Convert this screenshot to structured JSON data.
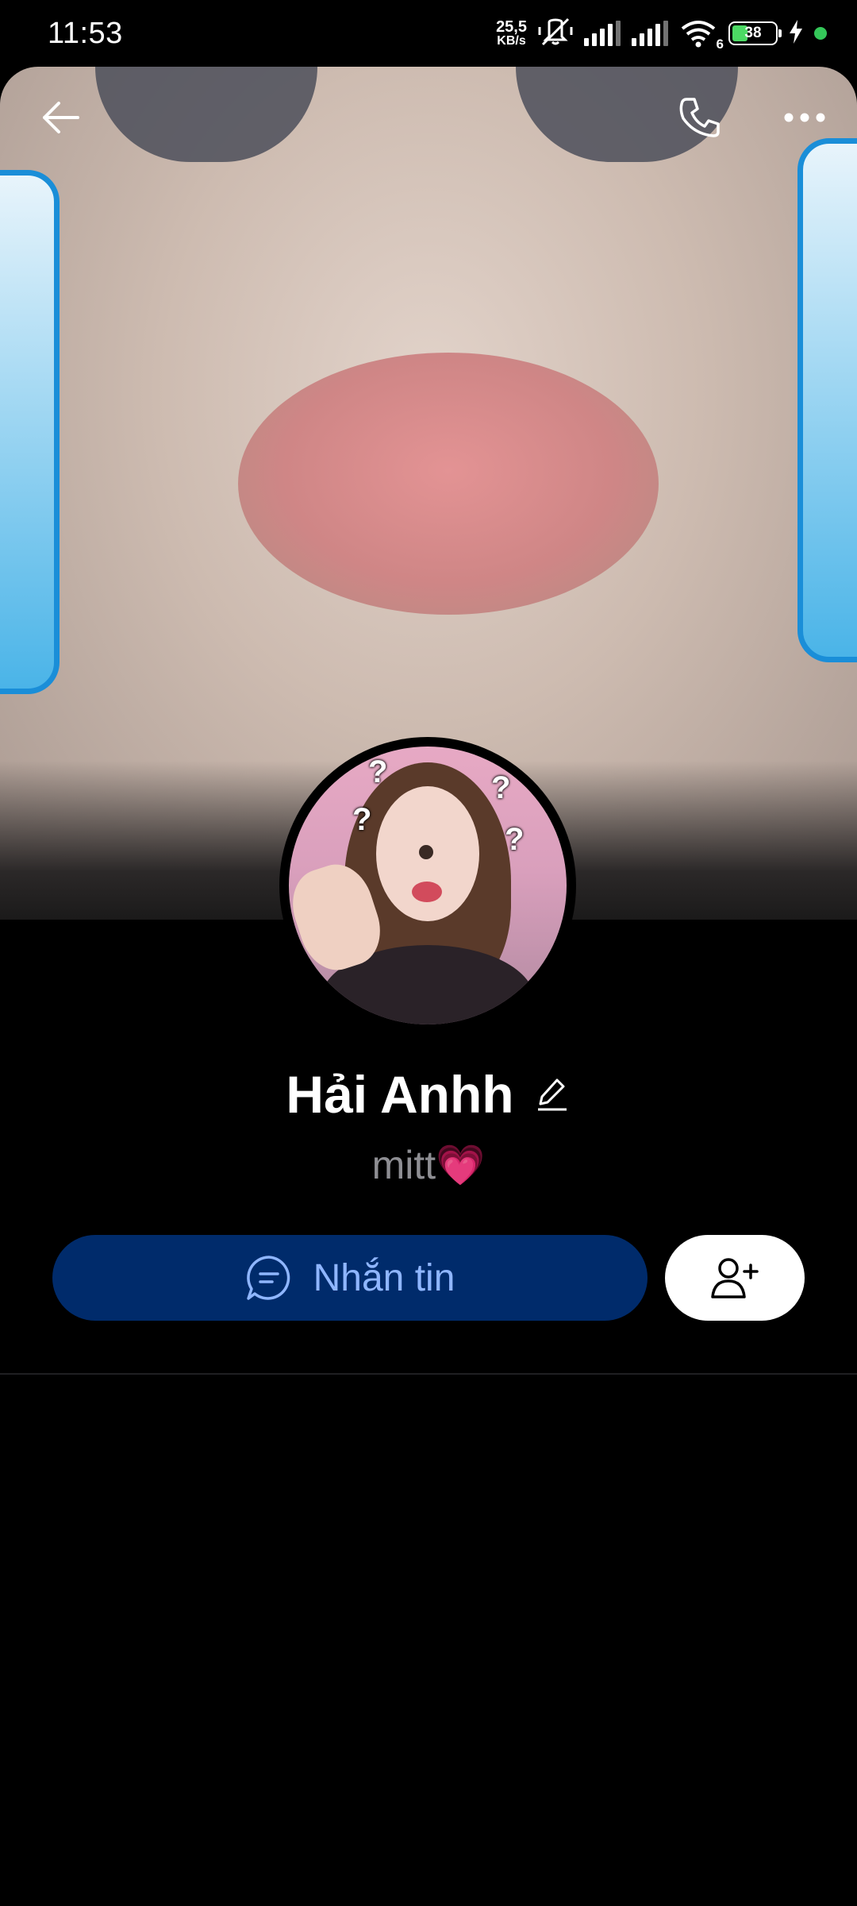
{
  "status_bar": {
    "time": "11:53",
    "net_speed_value": "25,5",
    "net_speed_unit": "KB/s",
    "wifi_badge": "6",
    "battery_level": "38"
  },
  "header": {
    "back_icon": "arrow-left-icon",
    "call_icon": "phone-icon",
    "more_icon": "more-horizontal-icon"
  },
  "profile": {
    "name": "Hải Anhh",
    "bio": "mitt💗"
  },
  "actions": {
    "message_label": "Nhắn tin",
    "message_icon": "chat-bubble-icon",
    "add_friend_icon": "user-plus-icon"
  },
  "colors": {
    "background": "#000000",
    "message_button_bg": "#002b6b",
    "message_button_text": "#8fb6ff",
    "bio_text": "#8e8e93"
  }
}
